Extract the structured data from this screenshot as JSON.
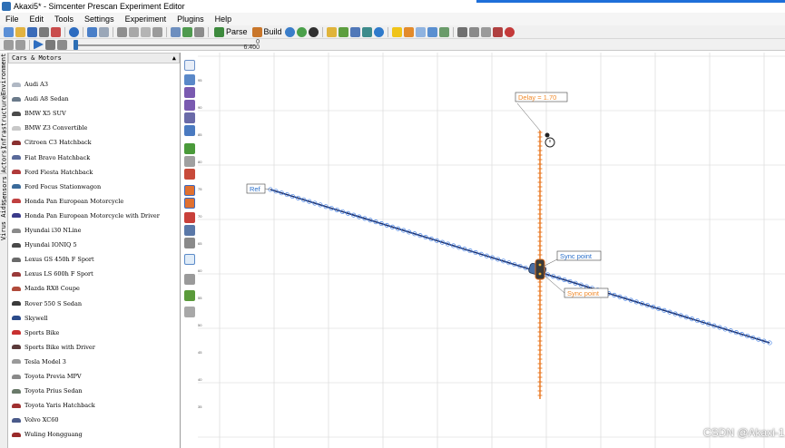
{
  "window": {
    "title": "Akaxi5* - Simcenter Prescan Experiment Editor"
  },
  "menu": [
    "File",
    "Edit",
    "Tools",
    "Settings",
    "Experiment",
    "Plugins",
    "Help"
  ],
  "toolbar": {
    "parse_label": "Parse",
    "build_label": "Build"
  },
  "playback": {
    "time_top": "0",
    "time_bottom": "6.400",
    "position": 0.0
  },
  "side_tabs": [
    "Environment",
    "Infrastructure",
    "Actors",
    "Sensors",
    "Virus Aids"
  ],
  "library": {
    "header": "Cars & Motors",
    "items": [
      "Audi A3",
      "Audi A8 Sedan",
      "BMW X5 SUV",
      "BMW Z3 Convertible",
      "Citroen C3 Hatchback",
      "Fiat Bravo Hatchback",
      "Ford Fiesta Hatchback",
      "Ford Focus Stationwagon",
      "Honda Pan European Motorcycle",
      "Honda Pan European Motorcycle with Driver",
      "Hyundai i30 NLine",
      "Hyundai IONIQ 5",
      "Lexus GS 450h F Sport",
      "Lexus LS 600h F Sport",
      "Mazda RX8 Coupe",
      "Rover 550 S Sedan",
      "Skywell",
      "Sports Bike",
      "Sports Bike with Driver",
      "Tesla Model 3",
      "Toyota Previa MPV",
      "Toyota Prius Sedan",
      "Toyota Yaris Hatchback",
      "Volvo XC60",
      "Wuling Hongguang"
    ]
  },
  "ruler": [
    "95",
    "90",
    "85",
    "80",
    "75",
    "70",
    "65",
    "60",
    "55",
    "50",
    "45",
    "40",
    "35"
  ],
  "scene": {
    "label_ref": "Ref",
    "label_delay": "Delay = 1.70",
    "label_sync_point_1": "Sync point",
    "label_sync_point_2": "Sync point"
  },
  "colors": {
    "trajectory_blue": "#1c2f6a",
    "waypoint_blue": "#4a86e8",
    "trajectory_orange": "#e8731a",
    "label_blue": "#2a6fc9",
    "label_orange": "#f0892a",
    "grid": "#d6d6d6"
  },
  "watermark": "CSDN @Akaxi-1"
}
